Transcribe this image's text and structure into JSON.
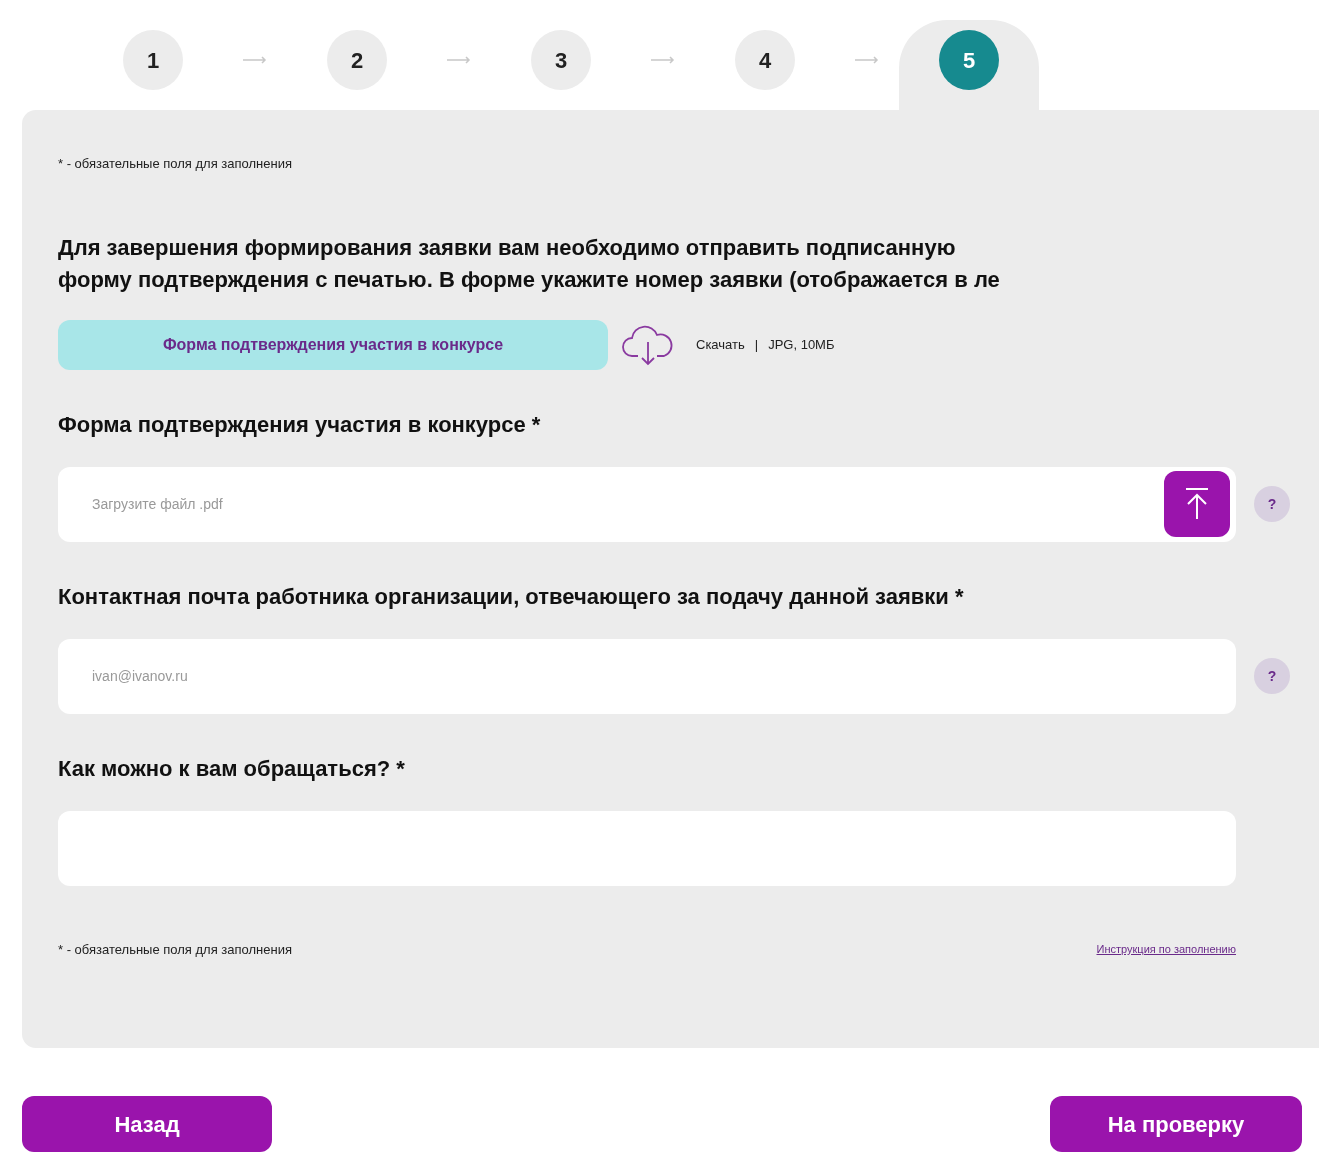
{
  "steps": [
    {
      "label": "1",
      "selected": false
    },
    {
      "label": "2",
      "selected": false
    },
    {
      "label": "3",
      "selected": false
    },
    {
      "label": "4",
      "selected": false
    },
    {
      "label": "5",
      "selected": true
    }
  ],
  "required_note_top": "* - обязательные поля для заполнения",
  "intro": "Для завершения формирования заявки вам необходимо отправить подписанную\nформу подтверждения с печатью. В форме укажите номер заявки (отображается в ле",
  "download": {
    "button": "Форма подтверждения участия в конкурсе",
    "link": "Скачать",
    "separator": "|",
    "info": "JPG, 10МБ"
  },
  "fields": [
    {
      "kind": "upload",
      "label": "Форма подтверждения участия в конкурсе *",
      "placeholder": "Загрузите файл .pdf",
      "help": "?"
    },
    {
      "kind": "text",
      "label": "Контактная почта работника организации, отвечающего за подачу данной заявки *",
      "placeholder": "ivan@ivanov.ru",
      "help": "?"
    },
    {
      "kind": "plain",
      "label": "Как можно к вам обращаться? *"
    }
  ],
  "required_note_bottom": "* - обязательные поля для заполнения",
  "instructions_link": "Инструкция по заполнению",
  "buttons": {
    "back": "Назад",
    "submit": "На проверку"
  }
}
